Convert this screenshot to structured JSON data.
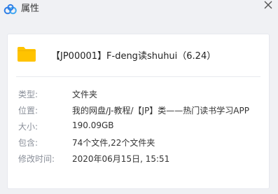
{
  "window": {
    "title": "属性"
  },
  "item": {
    "name": "【JP00001】F-deng读shuhui（6.24）"
  },
  "properties": [
    {
      "label": "类型:",
      "value": "文件夹"
    },
    {
      "label": "位置:",
      "value": "我的网盘/J-教程/【JP】类——热门读书学习APP"
    },
    {
      "label": "大小:",
      "value": "190.09GB"
    },
    {
      "label": "包含:",
      "value": "74个文件,22个文件夹"
    },
    {
      "label": "修改时间:",
      "value": "2020年06月15日, 15:51"
    }
  ],
  "colors": {
    "brand_blue": "#2f7fe6",
    "folder_yellow": "#ffc300"
  },
  "icons": {
    "app": "baidu-netdisk-cloud-icon",
    "close": "close-icon",
    "item": "folder-icon"
  }
}
